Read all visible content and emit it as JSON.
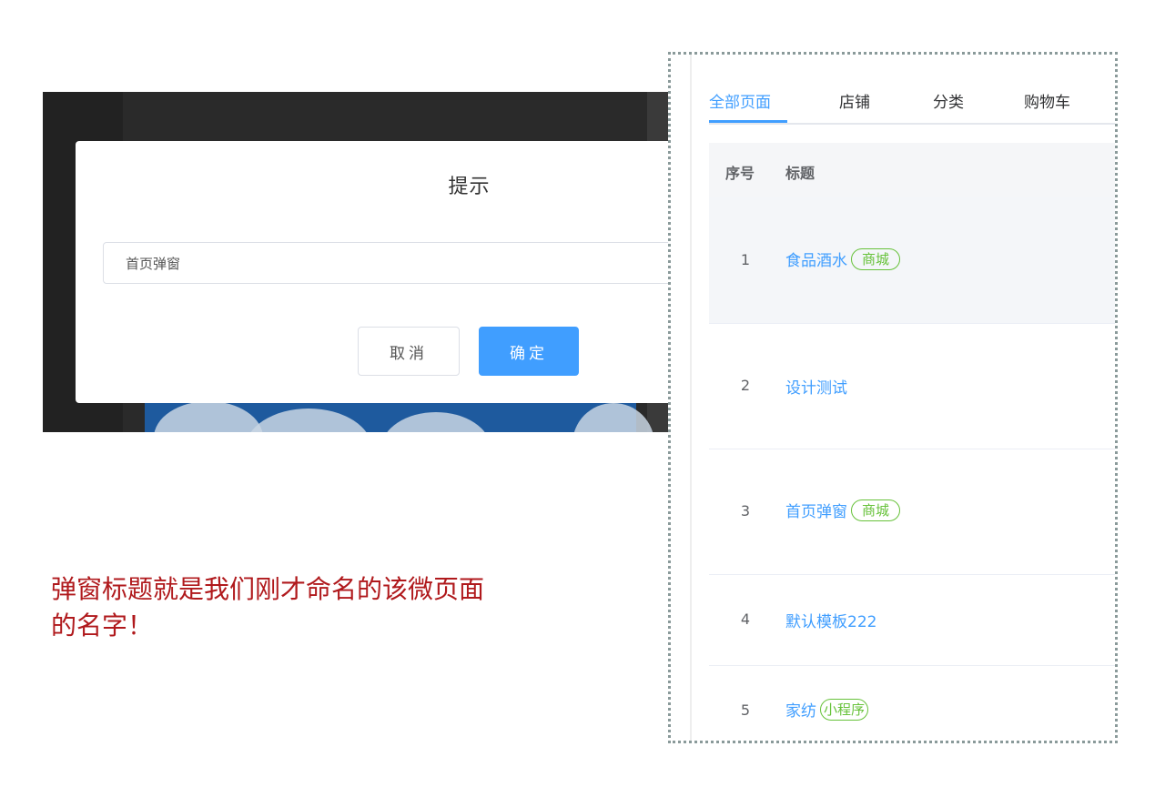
{
  "dialog": {
    "title": "提示",
    "input_value": "首页弹窗",
    "cancel_label": "取消",
    "ok_label": "确定"
  },
  "annotation": {
    "line1": "弹窗标题就是我们刚才命名的该微页面",
    "line2": "的名字！"
  },
  "tabs": [
    {
      "label": "全部页面",
      "active": true
    },
    {
      "label": "店铺",
      "active": false
    },
    {
      "label": "分类",
      "active": false
    },
    {
      "label": "购物车",
      "active": false
    }
  ],
  "table": {
    "headers": {
      "no": "序号",
      "title": "标题"
    },
    "rows": [
      {
        "no": "1",
        "title": "食品酒水",
        "tag": "商城"
      },
      {
        "no": "2",
        "title": "设计测试",
        "tag": ""
      },
      {
        "no": "3",
        "title": "首页弹窗",
        "tag": "商城"
      },
      {
        "no": "4",
        "title": "默认模板222",
        "tag": ""
      },
      {
        "no": "5",
        "title": "家纺",
        "tag": "小程序"
      }
    ]
  },
  "colors": {
    "primary": "#409eff",
    "tag_green": "#67c23a",
    "annotation_red": "#b0191c"
  }
}
